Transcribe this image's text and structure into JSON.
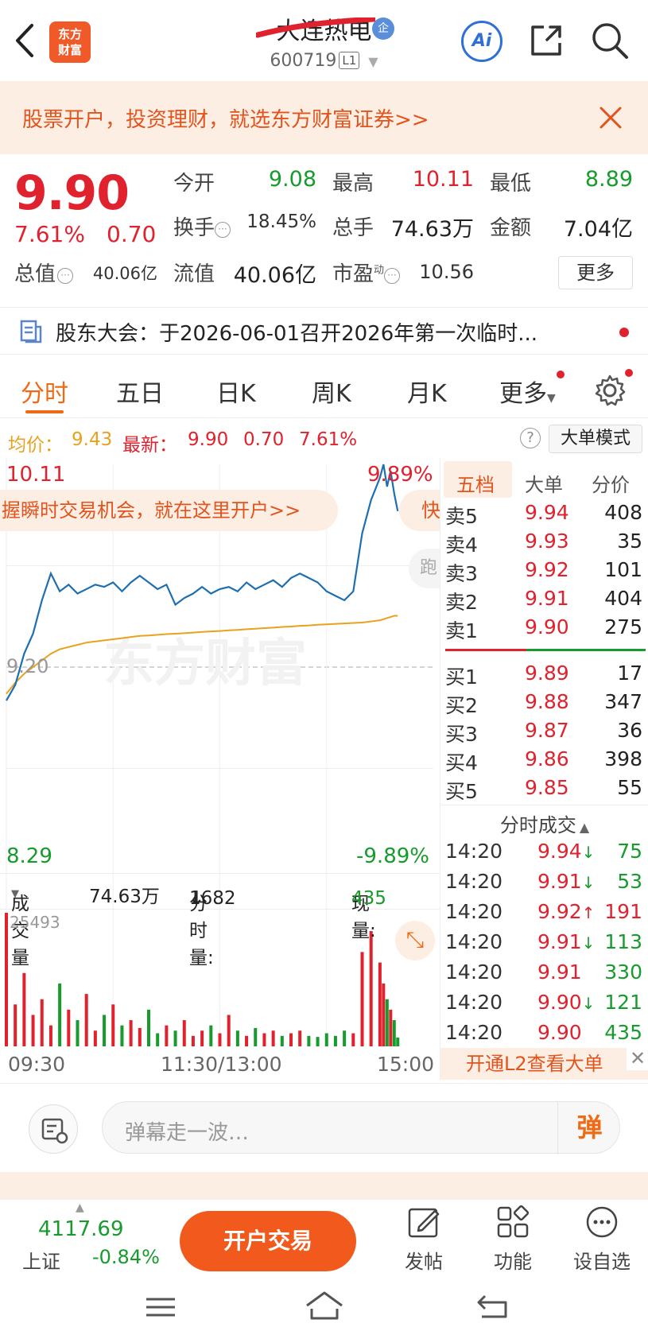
{
  "header": {
    "title": "大连热电",
    "badge": "企",
    "code": "600719",
    "level": "L1",
    "logo_line1": "东方",
    "logo_line2": "财富",
    "ai_label": "Ai"
  },
  "banner": {
    "text": "股票开户，投资理财，就选东方财富证券>>"
  },
  "quote": {
    "price": "9.90",
    "change_pct": "7.61%",
    "change_abs": "0.70",
    "open_label": "今开",
    "open": "9.08",
    "high_label": "最高",
    "high": "10.11",
    "low_label": "最低",
    "low": "8.89",
    "turnover_label": "换手",
    "turnover": "18.45%",
    "volume_label": "总手",
    "volume": "74.63万",
    "amount_label": "金额",
    "amount": "7.04亿",
    "mktcap_label": "总值",
    "mktcap": "40.06亿",
    "float_label": "流值",
    "float_cap": "40.06亿",
    "pe_label": "市盈",
    "pe_sup": "动",
    "pe": "10.56",
    "more_label": "更多"
  },
  "notice": {
    "text": "股东大会：于2026-06-01召开2026年第一次临时..."
  },
  "tabs": [
    "分时",
    "五日",
    "日K",
    "周K",
    "月K",
    "更多"
  ],
  "info_row": {
    "avg_label": "均价：",
    "avg": "9.43",
    "latest_label": "最新：",
    "latest": "9.90",
    "latest_chg": "0.70",
    "latest_pct": "7.61%",
    "bigorder_label": "大单模式",
    "help": "?"
  },
  "chart": {
    "y_max_label": "10.11",
    "y_min_label": "8.29",
    "pct_max_label": "9.89%",
    "pct_min_label": "-9.89%",
    "mid_label": "9.20",
    "watermark": "东方财富",
    "open_banner": "握瞬时交易机会，就在这里开户>>",
    "open_banner2": "快",
    "side_peek": "跑",
    "vol_label": "成交量",
    "vol_total": "74.63万",
    "minute_vol_label": "分时量:",
    "minute_vol": "1682",
    "minute_vol_arrow": "↓",
    "now_vol_label": "现量:",
    "now_vol": "435",
    "vol_max_label": "25493",
    "time_start": "09:30",
    "time_mid": "11:30/13:00",
    "time_end": "15:00"
  },
  "chart_data": {
    "type": "line",
    "title": "",
    "xlabel": "",
    "ylabel": "",
    "ylim": [
      8.29,
      10.11
    ],
    "x": [
      0,
      5,
      10,
      15,
      20,
      25,
      30,
      35,
      40,
      45,
      50,
      55,
      60,
      65,
      70,
      75,
      80,
      85,
      90,
      95,
      100,
      105,
      110,
      115,
      120,
      125,
      130,
      135,
      140,
      145,
      150,
      155,
      160,
      165,
      170,
      175,
      180,
      185,
      190,
      195,
      200,
      205,
      210,
      212,
      214,
      216,
      218,
      220
    ],
    "series": [
      {
        "values": [
          9.05,
          9.12,
          9.26,
          9.35,
          9.5,
          9.62,
          9.54,
          9.57,
          9.53,
          9.55,
          9.57,
          9.56,
          9.58,
          9.54,
          9.58,
          9.61,
          9.58,
          9.55,
          9.57,
          9.48,
          9.51,
          9.53,
          9.56,
          9.53,
          9.55,
          9.56,
          9.54,
          9.58,
          9.55,
          9.57,
          9.59,
          9.56,
          9.6,
          9.62,
          9.6,
          9.58,
          9.54,
          9.52,
          9.5,
          9.54,
          9.8,
          9.95,
          10.05,
          10.11,
          10.01,
          10.08,
          9.98,
          9.9
        ]
      },
      {
        "values": [
          9.08,
          9.13,
          9.17,
          9.2,
          9.23,
          9.26,
          9.28,
          9.29,
          9.3,
          9.31,
          9.315,
          9.32,
          9.325,
          9.33,
          9.335,
          9.34,
          9.342,
          9.345,
          9.348,
          9.35,
          9.352,
          9.355,
          9.358,
          9.36,
          9.362,
          9.365,
          9.367,
          9.37,
          9.372,
          9.375,
          9.377,
          9.38,
          9.382,
          9.385,
          9.387,
          9.39,
          9.392,
          9.394,
          9.396,
          9.398,
          9.4,
          9.405,
          9.41,
          9.415,
          9.42,
          9.425,
          9.43,
          9.43
        ]
      }
    ],
    "volume": [
      25493,
      8000,
      14000,
      6000,
      9000,
      4000,
      12000,
      7000,
      5000,
      10000,
      3000,
      6000,
      8000,
      4000,
      5000,
      3500,
      7000,
      2500,
      4000,
      3000,
      5000,
      2000,
      3000,
      4000,
      2500,
      6000,
      3000,
      2000,
      3500,
      2500,
      3000,
      2000,
      2500,
      3000,
      2000,
      1800,
      2500,
      2000,
      3000,
      2500,
      18000,
      22000,
      16000,
      12000,
      9000,
      7000,
      5000,
      1682
    ],
    "grid": true
  },
  "side": {
    "tabs": [
      "五档",
      "大单",
      "分价"
    ],
    "asks": [
      {
        "label": "卖5",
        "price": "9.94",
        "vol": "408"
      },
      {
        "label": "卖4",
        "price": "9.93",
        "vol": "35"
      },
      {
        "label": "卖3",
        "price": "9.92",
        "vol": "101"
      },
      {
        "label": "卖2",
        "price": "9.91",
        "vol": "404"
      },
      {
        "label": "卖1",
        "price": "9.90",
        "vol": "275"
      }
    ],
    "bids": [
      {
        "label": "买1",
        "price": "9.89",
        "vol": "17"
      },
      {
        "label": "买2",
        "price": "9.88",
        "vol": "347"
      },
      {
        "label": "买3",
        "price": "9.87",
        "vol": "36"
      },
      {
        "label": "买4",
        "price": "9.86",
        "vol": "398"
      },
      {
        "label": "买5",
        "price": "9.85",
        "vol": "55"
      }
    ],
    "ticks_title": "分时成交",
    "ticks": [
      {
        "time": "14:20",
        "price": "9.94",
        "arrow": "↓",
        "vol": "75"
      },
      {
        "time": "14:20",
        "price": "9.91",
        "arrow": "↓",
        "vol": "53"
      },
      {
        "time": "14:20",
        "price": "9.92",
        "arrow": "↑",
        "vol": "191"
      },
      {
        "time": "14:20",
        "price": "9.91",
        "arrow": "↓",
        "vol": "113"
      },
      {
        "time": "14:20",
        "price": "9.91",
        "arrow": "",
        "vol": "330"
      },
      {
        "time": "14:20",
        "price": "9.90",
        "arrow": "↓",
        "vol": "121"
      },
      {
        "time": "14:20",
        "price": "9.90",
        "arrow": "",
        "vol": "435"
      }
    ],
    "l2_banner": "开通L2查看大单",
    "l2_close": "✕"
  },
  "danmaku": {
    "placeholder": "弹幕走一波…",
    "button": "弹"
  },
  "bottom": {
    "index_value": "4117.69",
    "index_name": "上证",
    "index_change": "-0.84%",
    "trade_label": "开户交易",
    "post_label": "发帖",
    "func_label": "功能",
    "watch_label": "设自选"
  },
  "colors": {
    "up": "#e0222e",
    "down": "#179b2d",
    "accent": "#ee6a15",
    "price_line": "#1f6fb0",
    "avg_line": "#e8a21e"
  }
}
